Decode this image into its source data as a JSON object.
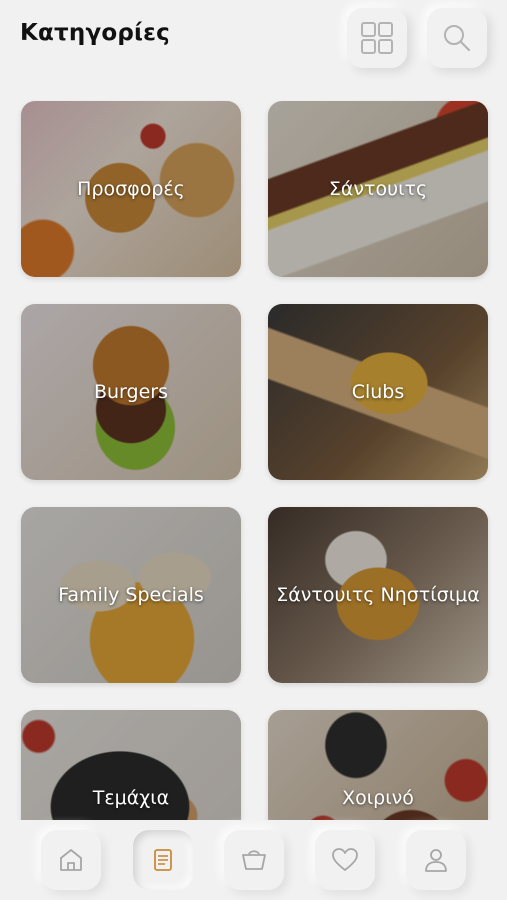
{
  "header": {
    "title": "Κατηγορίες",
    "grid_icon": "grid-view-icon",
    "search_icon": "search-icon"
  },
  "categories": [
    {
      "label": "Προσφορές"
    },
    {
      "label": "Σάντουιτς"
    },
    {
      "label": "Burgers"
    },
    {
      "label": "Clubs"
    },
    {
      "label": "Family Specials"
    },
    {
      "label": "Σάντουιτς Νηστίσιμα"
    },
    {
      "label": "Τεμάχια"
    },
    {
      "label": "Χοιρινό"
    }
  ],
  "bottom_nav": {
    "items": [
      {
        "icon": "home-icon"
      },
      {
        "icon": "menu-icon",
        "active": true
      },
      {
        "icon": "basket-icon"
      },
      {
        "icon": "heart-icon"
      },
      {
        "icon": "user-icon"
      }
    ],
    "active_color": "#c98a3a",
    "icon_color": "#9a9a9a"
  }
}
